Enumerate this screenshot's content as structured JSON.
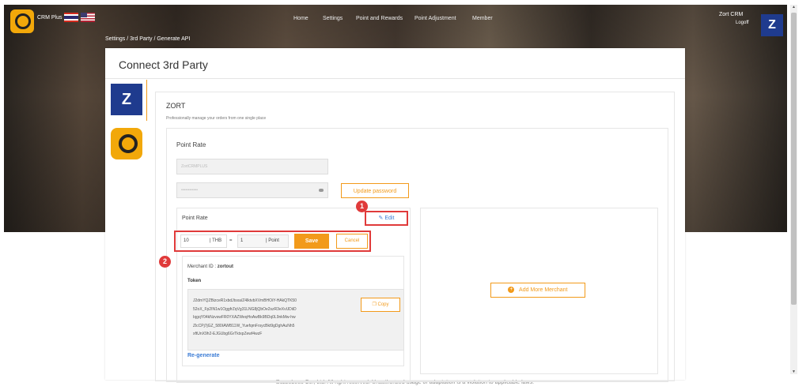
{
  "header": {
    "app_name": "CRM Plus",
    "nav": [
      "Home",
      "Settings",
      "Point and Rewards",
      "Point Adjustment",
      "Member"
    ],
    "user_name": "Zort CRM",
    "logoff_label": "Logoff",
    "zort_logo_char": "Z"
  },
  "breadcrumb": "Settings  /  3rd Party  /  Generate API",
  "page": {
    "title": "Connect 3rd Party",
    "tabs": [
      {
        "name": "Zort",
        "icon": "zort-logo-icon",
        "char": "Z"
      },
      {
        "name": "Buzzebees",
        "icon": "buzzebees-logo-icon"
      }
    ]
  },
  "partner": {
    "name": "ZORT",
    "description": "Professionally manage your orders from one single place",
    "section_title": "Point Rate",
    "username_value": "ZortCRMPLUS",
    "password_value": "••••••••••••",
    "update_password_label": "Update password"
  },
  "point_rate": {
    "title": "Point Rate",
    "edit_label": "Edit",
    "baht_value": "10",
    "baht_unit": "| THB",
    "equals": "=",
    "point_value": "1",
    "point_unit": "| Point",
    "save_label": "Save",
    "cancel_label": "Cancel",
    "marker_1": "1",
    "marker_2": "2"
  },
  "merchant": {
    "id_label": "Merchant ID :",
    "id_value": "zortout",
    "token_label": "Token",
    "token_lines": [
      "J2dmYQZBizceR1xbdJtsxa/Z4lktvbXVmBHOiY-HAkQTK50",
      "52oX_Fp2IN1w1OggfrZqVg31LNG8jQbOe2szR3eXvUDiiD",
      "IqgqY04kNzvswFR0YXAZWeqHoAwBk9BDq0L9nkMw-hw",
      "ZlcCPj7jGZ_580IAWB11W_YuefqmFrsycBkt9gDghAuNh5",
      "xftUnX9h2-EJGUbg6GrTktxpZewf4wzF"
    ],
    "copy_label": "Copy",
    "regenerate_label": "Re-generate"
  },
  "add_merchant_label": "Add More Merchant",
  "footer": "Buzzebees Co., Ltd. All right reserved. Unauthorized usage or adaptation is a violation to applicable laws.",
  "colors": {
    "accent": "#f29a1a",
    "highlight": "#e03a3a",
    "link": "#3a7bd5",
    "zort_blue": "#1f3b8e"
  }
}
